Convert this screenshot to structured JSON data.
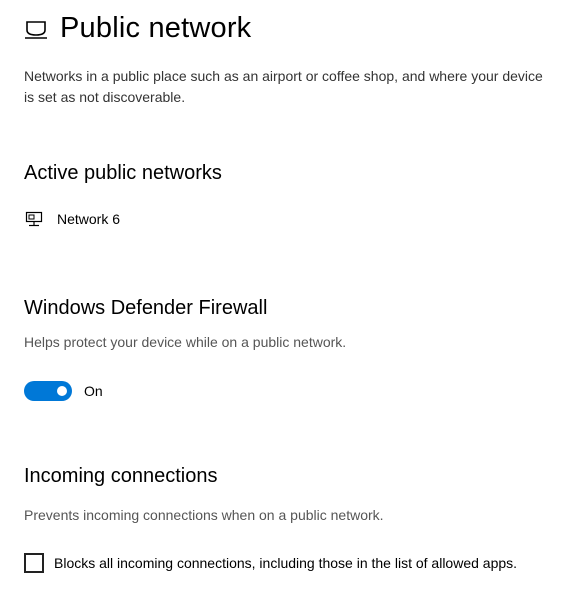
{
  "header": {
    "icon": "public-network-icon",
    "title": "Public network",
    "description": "Networks in a public place such as an airport or coffee shop, and where your device is set as not discoverable."
  },
  "active_networks": {
    "heading": "Active public networks",
    "items": [
      {
        "icon": "ethernet-network-icon",
        "name": "Network 6"
      }
    ]
  },
  "firewall": {
    "heading": "Windows Defender Firewall",
    "help": "Helps protect your device while on a public network.",
    "toggle_state": "On",
    "toggle_on": true,
    "accent_color": "#0078d7"
  },
  "incoming": {
    "heading": "Incoming connections",
    "help": "Prevents incoming connections when on a public network.",
    "checkbox_label": "Blocks all incoming connections, including those in the list of allowed apps.",
    "checked": false
  }
}
